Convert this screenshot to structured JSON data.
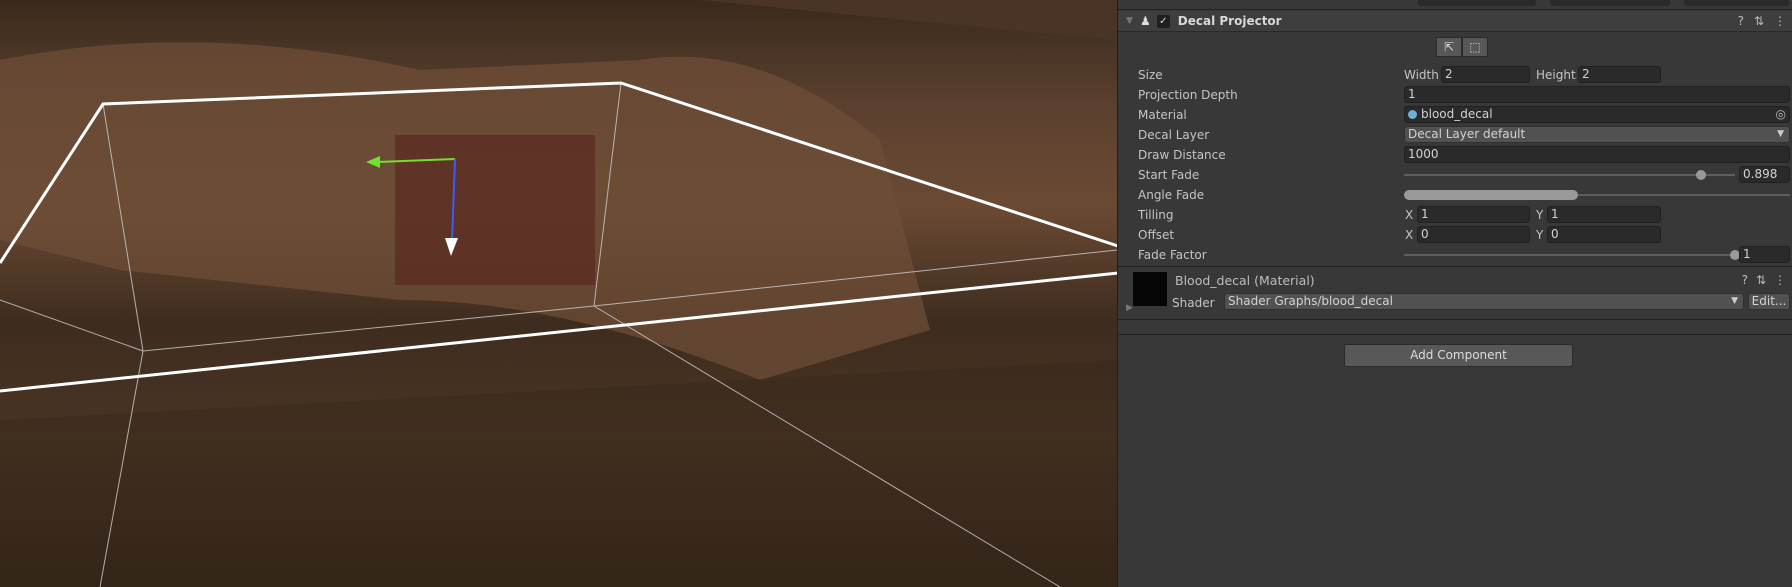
{
  "component": {
    "title": "Decal Projector",
    "enabled": true
  },
  "fields": {
    "size": {
      "label": "Size",
      "width_label": "Width",
      "width": "2",
      "height_label": "Height",
      "height": "2"
    },
    "projection_depth": {
      "label": "Projection Depth",
      "value": "1"
    },
    "material": {
      "label": "Material",
      "value": "blood_decal"
    },
    "decal_layer": {
      "label": "Decal Layer",
      "value": "Decal Layer default"
    },
    "draw_distance": {
      "label": "Draw Distance",
      "value": "1000"
    },
    "start_fade": {
      "label": "Start Fade",
      "value": "0.898",
      "fraction": 0.898
    },
    "angle_fade": {
      "label": "Angle Fade",
      "range": [
        0,
        0.5
      ]
    },
    "tilling": {
      "label": "Tilling",
      "x_label": "X",
      "x": "1",
      "y_label": "Y",
      "y": "1"
    },
    "offset": {
      "label": "Offset",
      "x_label": "X",
      "x": "0",
      "y_label": "Y",
      "y": "0"
    },
    "fade_factor": {
      "label": "Fade Factor",
      "value": "1",
      "fraction": 1
    }
  },
  "material_section": {
    "title": "Blood_decal (Material)",
    "shader_label": "Shader",
    "shader": "Shader Graphs/blood_decal",
    "edit": "Edit..."
  },
  "add_component": "Add Component"
}
